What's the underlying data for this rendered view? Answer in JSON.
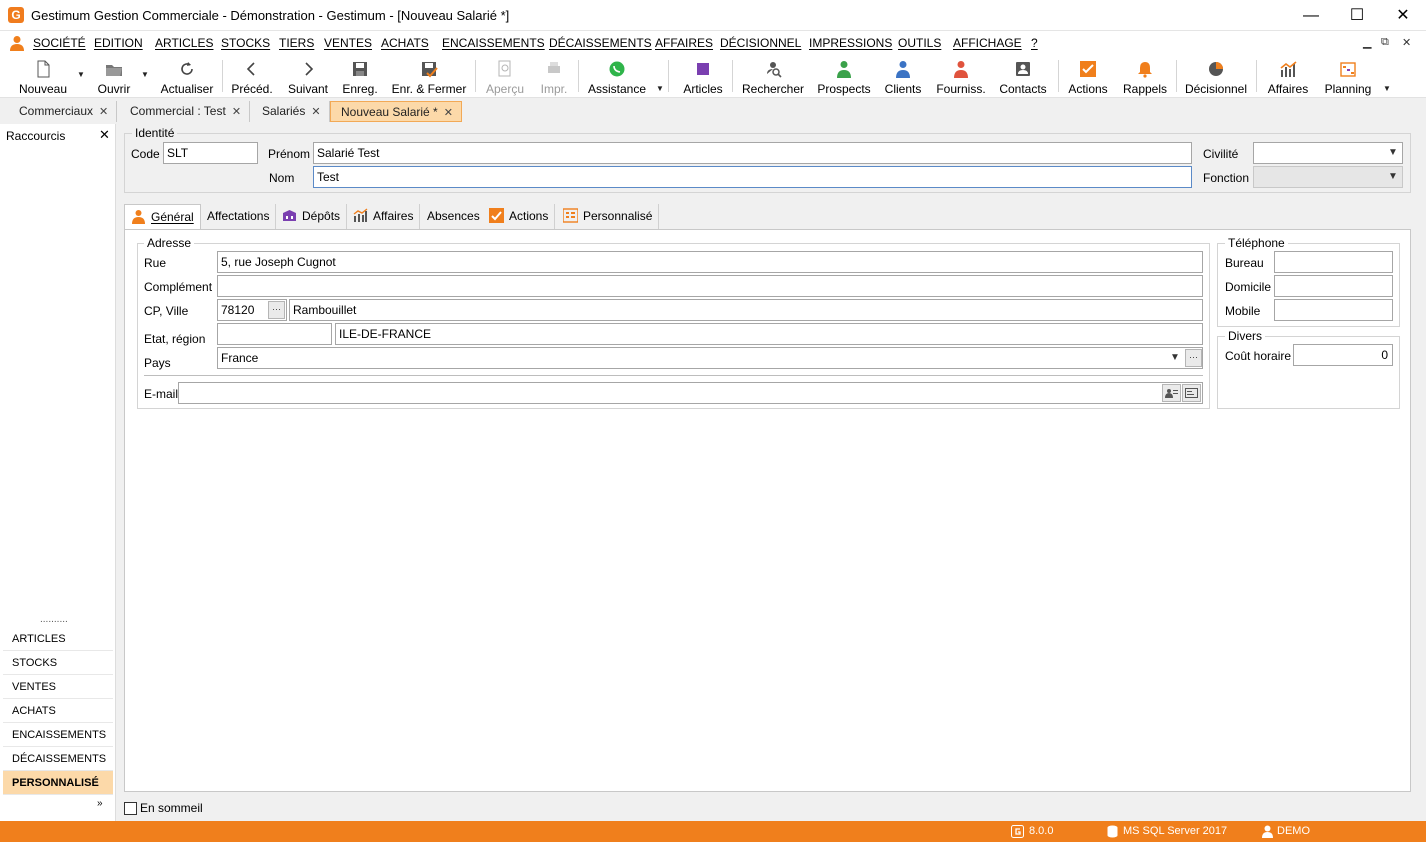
{
  "window": {
    "title": "Gestimum Gestion Commerciale - Démonstration - Gestimum - [Nouveau Salarié *]",
    "logo_letter": "G",
    "minimize": "—",
    "maximize": "☐",
    "close": "✕"
  },
  "menu": {
    "items": [
      "SOCIÉTÉ",
      "EDITION",
      "ARTICLES",
      "STOCKS",
      "TIERS",
      "VENTES",
      "ACHATS",
      "ENCAISSEMENTS",
      "DÉCAISSEMENTS",
      "AFFAIRES",
      "DÉCISIONNEL",
      "IMPRESSIONS",
      "OUTILS",
      "AFFICHAGE",
      "?"
    ],
    "mdi_controls": [
      "▁",
      "⧉",
      "✕"
    ]
  },
  "toolbar": {
    "nouveau": "Nouveau",
    "ouvrir": "Ouvrir",
    "actualiser": "Actualiser",
    "preced": "Précéd.",
    "suivant": "Suivant",
    "enreg": "Enreg.",
    "enr_fermer": "Enr. & Fermer",
    "apercu": "Aperçu",
    "impr": "Impr.",
    "assistance": "Assistance",
    "articles": "Articles",
    "rechercher": "Rechercher",
    "prospects": "Prospects",
    "clients": "Clients",
    "fourniss": "Fourniss.",
    "contacts": "Contacts",
    "actions": "Actions",
    "rappels": "Rappels",
    "decisionnel": "Décisionnel",
    "affaires": "Affaires",
    "planning": "Planning"
  },
  "doc_tabs": [
    {
      "label": "Commerciaux",
      "close": "✕"
    },
    {
      "label": "Commercial : Test",
      "close": "✕"
    },
    {
      "label": "Salariés",
      "close": "✕"
    },
    {
      "label": "Nouveau Salarié *",
      "close": "✕"
    }
  ],
  "left_panel": {
    "title": "Raccourcis",
    "close": "✕",
    "dots": "..........",
    "items": [
      "ARTICLES",
      "STOCKS",
      "VENTES",
      "ACHATS",
      "ENCAISSEMENTS",
      "DÉCAISSEMENTS",
      "PERSONNALISÉ"
    ],
    "more": "»"
  },
  "identite": {
    "title": "Identité",
    "code_label": "Code",
    "code_value": "SLT",
    "prenom_label": "Prénom",
    "prenom_value": "Salarié Test",
    "nom_label": "Nom",
    "nom_value": "Test",
    "civilite_label": "Civilité",
    "civilite_value": "",
    "fonction_label": "Fonction",
    "fonction_value": ""
  },
  "sub_tabs": [
    "Général",
    "Affectations",
    "Dépôts",
    "Affaires",
    "Absences",
    "Actions",
    "Personnalisé"
  ],
  "adresse": {
    "title": "Adresse",
    "rue_label": "Rue",
    "rue_value": "5, rue Joseph Cugnot",
    "complement_label": "Complément",
    "complement_value": "",
    "cpville_label": "CP, Ville",
    "cp_value": "78120",
    "ville_value": "Rambouillet",
    "etat_label": "Etat, région",
    "etat_value": "",
    "region_value": "ILE-DE-FRANCE",
    "pays_label": "Pays",
    "pays_value": "France",
    "email_label": "E-mail",
    "email_value": "",
    "dots": "···"
  },
  "telephone": {
    "title": "Téléphone",
    "bureau_label": "Bureau",
    "bureau_value": "",
    "domicile_label": "Domicile",
    "domicile_value": "",
    "mobile_label": "Mobile",
    "mobile_value": ""
  },
  "divers": {
    "title": "Divers",
    "cout_label": "Coût horaire",
    "cout_value": "0"
  },
  "footer": {
    "sommeil_label": "En sommeil"
  },
  "status": {
    "version": "8.0.0",
    "server": "MS SQL Server 2017",
    "user": "DEMO"
  },
  "colors": {
    "accent": "#f07f1c",
    "active_tab": "#fcd9a9",
    "prospects_green": "#3aa14a",
    "clients_blue": "#3b73c4",
    "fourniss_red": "#e0533d",
    "articles_purple": "#7a3fb0"
  }
}
